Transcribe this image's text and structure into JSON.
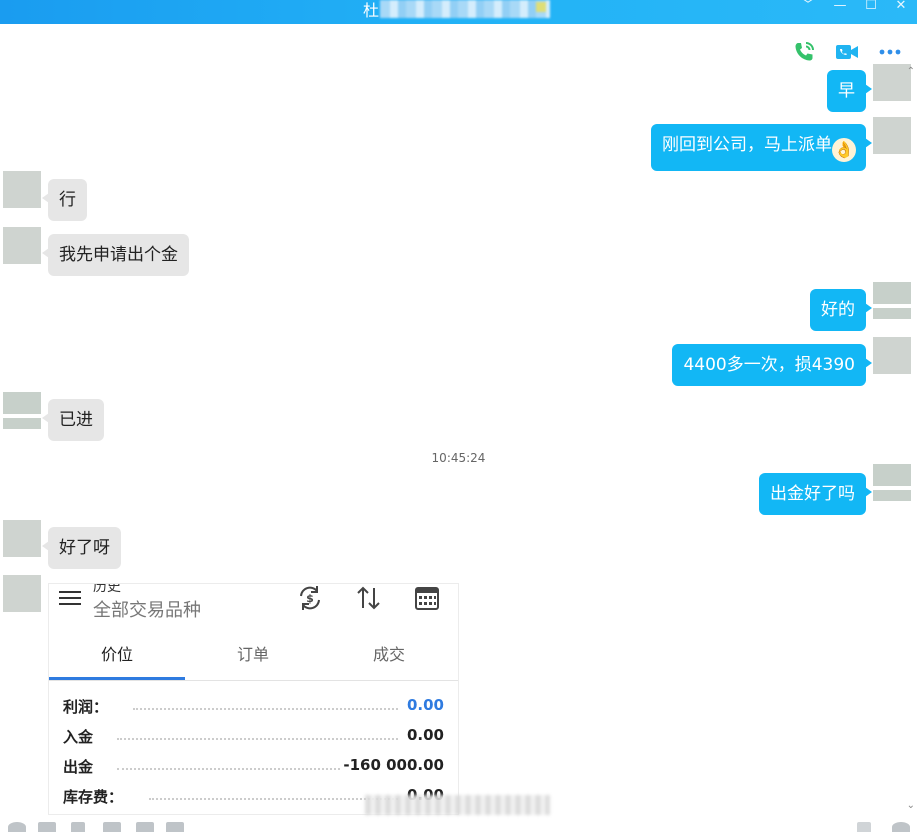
{
  "window": {
    "title": "杜",
    "controls": [
      "﹀",
      "—",
      "☐",
      "✕"
    ]
  },
  "toolbar": {
    "icons": [
      "phone-icon",
      "video-call-icon",
      "more-icon"
    ],
    "colors": {
      "phone": "#35c26b",
      "video": "#20b4f1",
      "more": "#2f8fe9"
    }
  },
  "messages": [
    {
      "side": "out",
      "text": "早"
    },
    {
      "side": "out",
      "text": "刚回到公司，马上派单",
      "emoji": "👌"
    },
    {
      "side": "in",
      "text": "行"
    },
    {
      "side": "in",
      "text": "我先申请出个金"
    },
    {
      "side": "out",
      "text": "好的"
    },
    {
      "side": "out",
      "text": "4400多一次，损4390"
    },
    {
      "side": "in",
      "text": "已进"
    },
    {
      "side": "out",
      "text": "出金好了吗"
    },
    {
      "side": "in",
      "text": "好了呀"
    }
  ],
  "timestamp": "10:45:24",
  "screenshot": {
    "header_cut": "历史",
    "subtitle": "全部交易品种",
    "tabs": [
      {
        "label": "价位",
        "active": true
      },
      {
        "label": "订单",
        "active": false
      },
      {
        "label": "成交",
        "active": false
      }
    ],
    "rows": [
      {
        "label": "利润：",
        "value": "0.00",
        "value_color": "#2f7be0"
      },
      {
        "label": "入金",
        "value": "0.00"
      },
      {
        "label": "出金",
        "value": "-160 000.00"
      },
      {
        "label": "库存费：",
        "value": "0.00"
      }
    ]
  },
  "colors": {
    "accent": "#12b7f5",
    "incoming_bubble": "#e6e6e6",
    "titlebar": "#1fa8f3"
  }
}
